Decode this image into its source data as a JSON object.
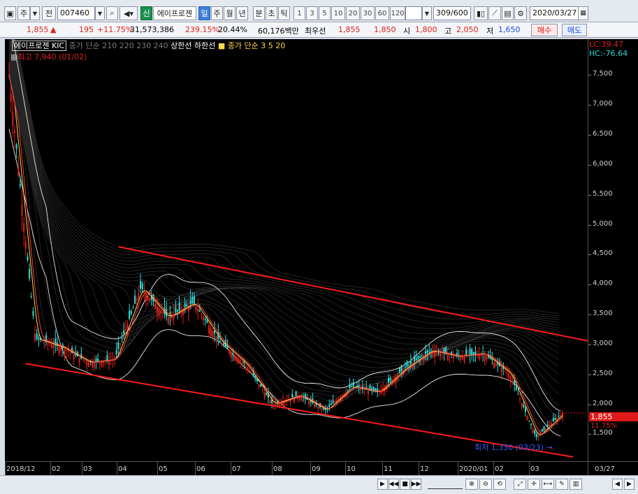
{
  "toolbar": {
    "market": "주",
    "prev": "전",
    "code": "007460",
    "new_badge": "신",
    "name": "에이프로젠",
    "period_tabs": [
      "일",
      "주",
      "월",
      "년",
      "분",
      "초",
      "틱"
    ],
    "interval_buttons": [
      "1",
      "3",
      "5",
      "10",
      "20",
      "30",
      "60",
      "120"
    ],
    "count": "309",
    "count_max": "600",
    "date": "2020/03/27"
  },
  "quote": {
    "price": "1,855",
    "change": "195",
    "change_pct": "+11.75%",
    "volume": "31,573,386",
    "vol_ratio": "239.15%",
    "turnover": "20.44%",
    "amount": "60,176백만",
    "pref_label": "최우선",
    "ask": "1,855",
    "bid": "1,850",
    "open_label": "시",
    "open": "1,800",
    "high_label": "고",
    "high": "2,050",
    "low_label": "저",
    "low": "1,650",
    "buy_label": "매수",
    "sell_label": "매도"
  },
  "chart": {
    "legend_title": "에이프로젠 KIC",
    "legend_ma_dim": "종가 단순 210 220 230 240",
    "legend_bands": "상한선 하한선",
    "legend_ma_label": "종가 단순",
    "legend_ma_periods": "3 5 20",
    "max_note": "최고 7,940 (01/02)",
    "min_note": "최저 1,330 (03/23)",
    "lc_label": "LC:39.47",
    "hc_label": "HC:-76.64",
    "price_badge": "1,855",
    "price_pct": "11.75%",
    "colors": {
      "up": "#e0201a",
      "down": "#2ee0e0",
      "channel": "#ff1a1a",
      "ma_yellow": "#ffd84a",
      "ma_red": "#ff4040"
    }
  },
  "chart_data": {
    "type": "candlestick",
    "title": "에이프로젠 KIC",
    "x_ticks": [
      "2018/12",
      "02",
      "03",
      "04",
      "05",
      "06",
      "07",
      "08",
      "09",
      "10",
      "11",
      "12",
      "2020/01",
      "02",
      "03",
      "03/27"
    ],
    "y_ticks": [
      "7,500",
      "7,000",
      "6,500",
      "6,000",
      "5,500",
      "5,000",
      "4,500",
      "4,000",
      "3,500",
      "3,000",
      "2,500",
      "2,000",
      "1,500"
    ],
    "ylim": [
      1050,
      8100
    ],
    "highest": {
      "value": 7940,
      "date": "01/02"
    },
    "lowest": {
      "value": 1330,
      "date": "03/23"
    },
    "last_close": 1855,
    "channel_upper": [
      [
        0.195,
        4630
      ],
      [
        1.0,
        3060
      ]
    ],
    "channel_lower": [
      [
        0.035,
        2680
      ],
      [
        0.975,
        1120
      ]
    ],
    "monthly_anchors": [
      {
        "m": "2018/12",
        "value": 7500
      },
      {
        "m": "12-late",
        "value": 3100
      },
      {
        "m": "01",
        "value": 2950
      },
      {
        "m": "02",
        "value": 2700
      },
      {
        "m": "03",
        "value": 2750
      },
      {
        "m": "04",
        "value": 3950
      },
      {
        "m": "05",
        "value": 3450
      },
      {
        "m": "06",
        "value": 3700
      },
      {
        "m": "06-late",
        "value": 3050
      },
      {
        "m": "07",
        "value": 2650
      },
      {
        "m": "08",
        "value": 2000
      },
      {
        "m": "09",
        "value": 2150
      },
      {
        "m": "10",
        "value": 1900
      },
      {
        "m": "10-mid",
        "value": 2300
      },
      {
        "m": "11",
        "value": 2200
      },
      {
        "m": "12",
        "value": 2600
      },
      {
        "m": "12-mid",
        "value": 2900
      },
      {
        "m": "2020/01",
        "value": 2800
      },
      {
        "m": "02",
        "value": 2850
      },
      {
        "m": "03",
        "value": 2500
      },
      {
        "m": "03-late",
        "value": 1450
      },
      {
        "m": "03/27",
        "value": 1855
      }
    ]
  },
  "scroll": {
    "buttons": [
      "▶",
      "◀◀",
      "■",
      "▶▶"
    ]
  }
}
